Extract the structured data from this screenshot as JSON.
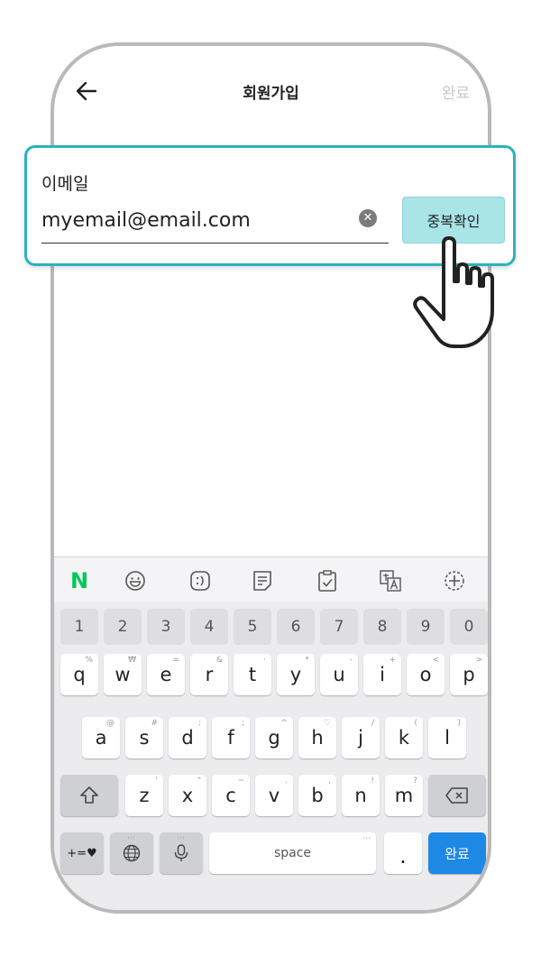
{
  "header": {
    "title": "회원가입",
    "done_label": "완료"
  },
  "email": {
    "label": "이메일",
    "value": "myemail@email.com",
    "clear_symbol": "✕",
    "dup_check_label": "중복확인"
  },
  "toolbar": {
    "n_logo": "N"
  },
  "keyboard": {
    "numbers": [
      "1",
      "2",
      "3",
      "4",
      "5",
      "6",
      "7",
      "8",
      "9",
      "0"
    ],
    "row1": [
      {
        "key": "q",
        "hint": "%"
      },
      {
        "key": "w",
        "hint": "₩"
      },
      {
        "key": "e",
        "hint": "="
      },
      {
        "key": "r",
        "hint": "&"
      },
      {
        "key": "t",
        "hint": "·"
      },
      {
        "key": "y",
        "hint": "*"
      },
      {
        "key": "u",
        "hint": "-"
      },
      {
        "key": "i",
        "hint": "+"
      },
      {
        "key": "o",
        "hint": "<"
      },
      {
        "key": "p",
        "hint": ">"
      }
    ],
    "row2": [
      {
        "key": "a",
        "hint": "@"
      },
      {
        "key": "s",
        "hint": "#"
      },
      {
        "key": "d",
        "hint": ":"
      },
      {
        "key": "f",
        "hint": ";"
      },
      {
        "key": "g",
        "hint": "^"
      },
      {
        "key": "h",
        "hint": "♡"
      },
      {
        "key": "j",
        "hint": "/"
      },
      {
        "key": "k",
        "hint": "("
      },
      {
        "key": "l",
        "hint": ")"
      }
    ],
    "row3": [
      {
        "key": "z",
        "hint": "'"
      },
      {
        "key": "x",
        "hint": "\""
      },
      {
        "key": "c",
        "hint": "~"
      },
      {
        "key": "v",
        "hint": "."
      },
      {
        "key": "b",
        "hint": ","
      },
      {
        "key": "n",
        "hint": "!"
      },
      {
        "key": "m",
        "hint": "?"
      }
    ],
    "symbols_label": "+=♥",
    "space_label": "space",
    "period_label": ".",
    "done_label": "완료",
    "ellipsis": "···"
  },
  "colors": {
    "accent": "#2ab3bd",
    "dup_button": "#a9e4e7",
    "keyboard_done": "#1e88e5",
    "naver_green": "#03c75a"
  }
}
